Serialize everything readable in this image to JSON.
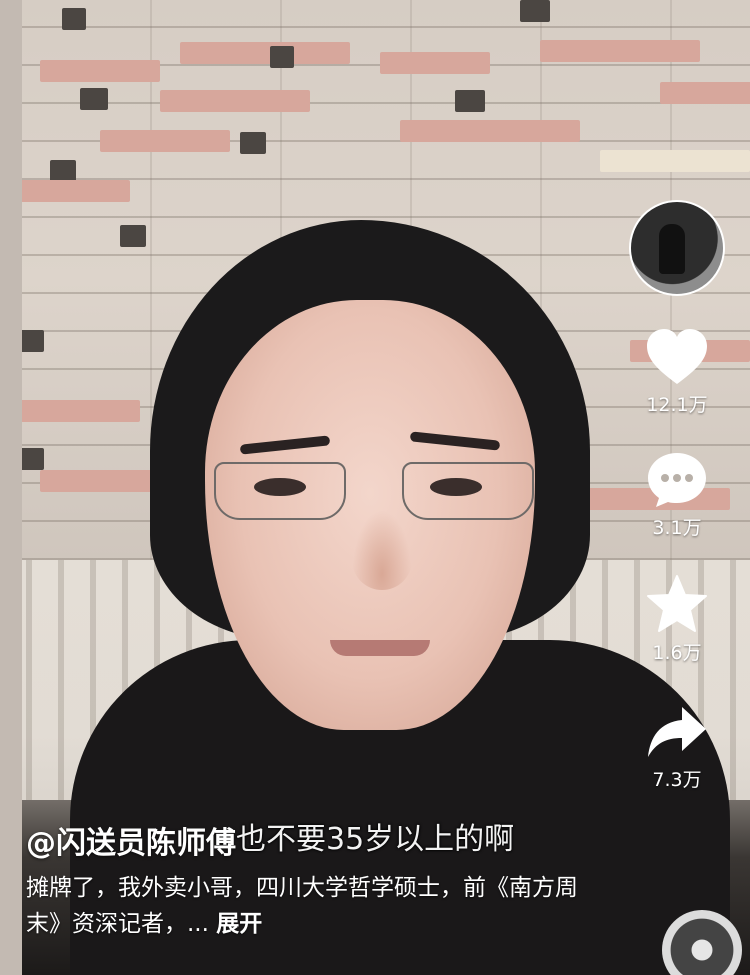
{
  "video": {
    "subtitle": "也不要35岁以上的啊",
    "author": "@闪送员陈师傅",
    "caption": "摊牌了，我外卖小哥，四川大学哲学硕士，前《南方周末》资深记者，...",
    "expand_label": "展开"
  },
  "actions": {
    "likes": "12.1万",
    "comments": "3.1万",
    "favorites": "1.6万",
    "shares": "7.3万"
  },
  "colors": {
    "overlay_text": "#ffffff",
    "icon_fill": "#ffffff"
  }
}
